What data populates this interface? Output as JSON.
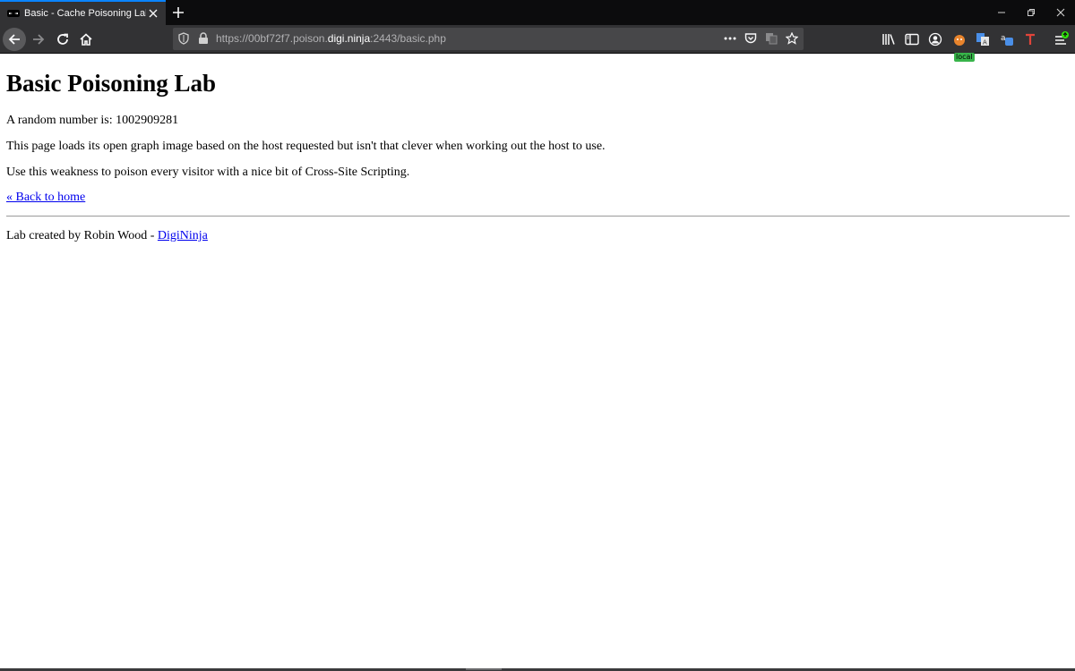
{
  "browser": {
    "tab_title": "Basic - Cache Poisoning Lab",
    "url_scheme": "https://",
    "url_subdomain": "00bf72f7.poison.",
    "url_domain": "digi.ninja",
    "url_rest": ":2443/basic.php",
    "extension_badge": "local",
    "icons": {
      "favicon": "ninja-favicon-icon",
      "close_tab": "close-icon",
      "new_tab": "plus-icon",
      "back": "arrow-left-icon",
      "forward": "arrow-right-icon",
      "reload": "reload-icon",
      "home": "home-icon",
      "tracking": "shield-icon",
      "lock": "lock-icon",
      "page_actions": "ellipsis-icon",
      "pocket": "pocket-icon",
      "translate": "translate-icon",
      "bookmark": "star-icon",
      "library": "library-icon",
      "sidebar": "sidebar-icon",
      "account": "account-icon",
      "menu": "hamburger-menu-icon"
    },
    "accent_color": "#0a84ff"
  },
  "page": {
    "heading": "Basic Poisoning Lab",
    "random_number_label": "A random number is: 1002909281",
    "description": "This page loads its open graph image based on the host requested but isn't that clever when working out the host to use.",
    "instruction": "Use this weakness to poison every visitor with a nice bit of Cross-Site Scripting.",
    "back_link": "« Back to home",
    "footer_text": "Lab created by Robin Wood - ",
    "footer_link": "DigiNinja"
  }
}
